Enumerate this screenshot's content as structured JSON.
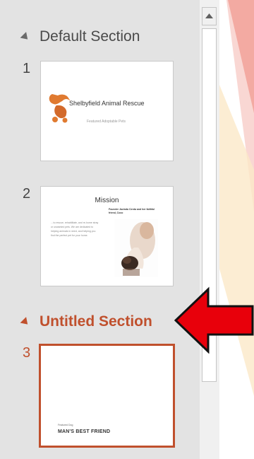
{
  "sections": [
    {
      "name": "Default Section"
    },
    {
      "name": "Untitled Section"
    }
  ],
  "slides": [
    {
      "number": "1",
      "title": "Shelbyfield Animal Rescue",
      "subtitle": "Featured Adoptable Pets"
    },
    {
      "number": "2",
      "title": "Mission",
      "body": "…to rescue, rehabilitate, and re-home stray or unwanted pets. We are dedicated to helping animals in need, and helping you find the perfect pet for your home.",
      "caption": "Founder Jacinda Cerda and her faithful friend, Coco"
    },
    {
      "number": "3",
      "small_text": "Featured Dog",
      "title": "MAN'S BEST FRIEND"
    }
  ],
  "colors": {
    "accent": "#c0502d",
    "pane_bg": "#e3e3e3",
    "annotation_arrow": "#e8000b"
  },
  "icons": {
    "collapse": "triangle-down-left-icon",
    "scroll_up": "scroll-up-arrow-icon"
  }
}
